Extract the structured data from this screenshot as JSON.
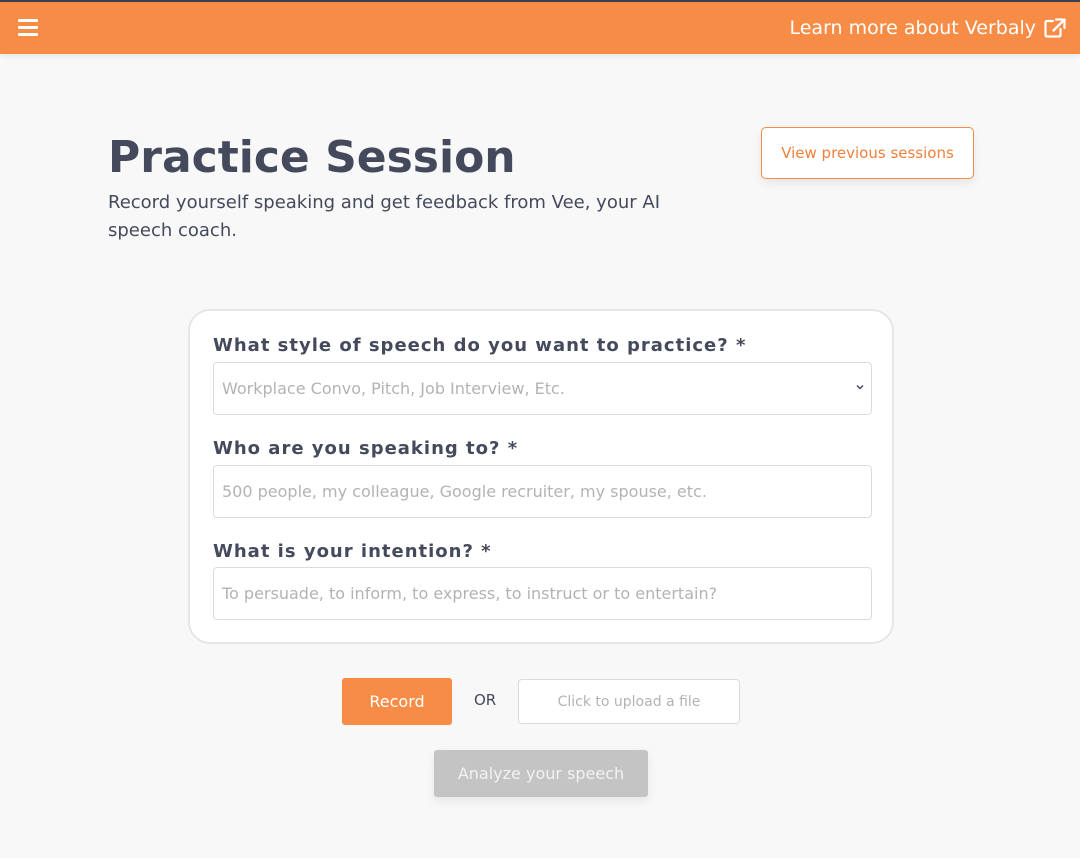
{
  "header": {
    "menu_icon": "hamburger-menu-icon",
    "learn_more_label": "Learn more about Verbaly",
    "external_icon": "external-link-icon",
    "accent_color": "#f78c46"
  },
  "page": {
    "title": "Practice Session",
    "subtitle": "Record yourself speaking and get feedback from Vee, your AI speech coach.",
    "view_previous_label": "View previous sessions"
  },
  "form": {
    "style_label": "What style of speech do you want to practice? *",
    "style_placeholder": "Workplace Convo, Pitch, Job Interview, Etc.",
    "audience_label": "Who are you speaking to? *",
    "audience_placeholder": "500 people, my colleague, Google recruiter, my spouse, etc.",
    "intention_label": "What is your intention? *",
    "intention_placeholder": "To persuade, to inform, to express, to instruct or to entertain?"
  },
  "actions": {
    "record_label": "Record",
    "or_label": "OR",
    "upload_label": "Click to upload a file",
    "analyze_label": "Analyze your speech"
  }
}
